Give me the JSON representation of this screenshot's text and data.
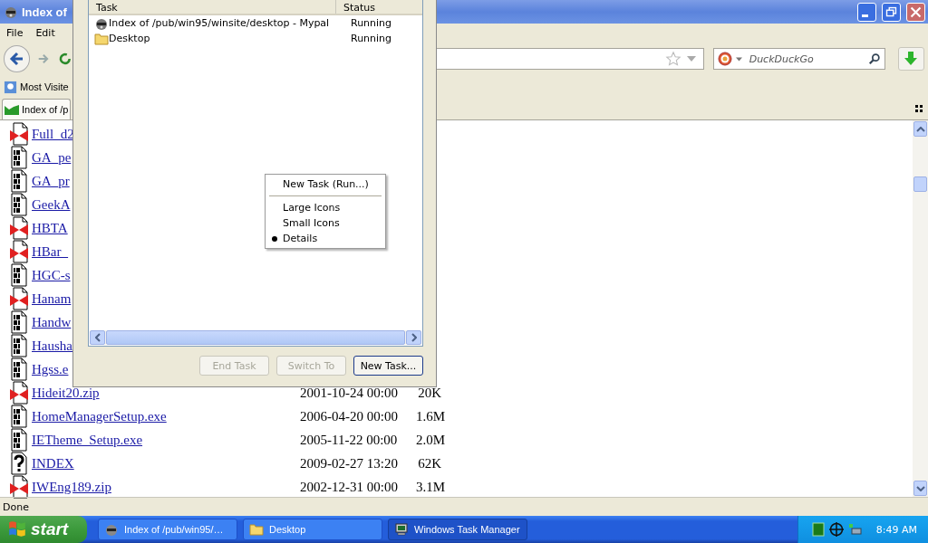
{
  "browser": {
    "title": "Index of",
    "menu": [
      "File",
      "Edit"
    ],
    "bookmarks": [
      "Most Visite"
    ],
    "tabs": [
      {
        "label": "Index of /p",
        "selected": true
      }
    ],
    "search": {
      "placeholder": "DuckDuckGo"
    },
    "files": [
      {
        "name": "Full_d2",
        "kind": "archive"
      },
      {
        "name": "GA_pe",
        "kind": "binary"
      },
      {
        "name": "GA_pr",
        "kind": "binary"
      },
      {
        "name": "GeekA",
        "kind": "binary"
      },
      {
        "name": "HBTA",
        "kind": "archive"
      },
      {
        "name": "HBar_",
        "kind": "archive"
      },
      {
        "name": "HGC-s",
        "kind": "binary"
      },
      {
        "name": "Hanam",
        "kind": "archive"
      },
      {
        "name": "Handw",
        "kind": "binary"
      },
      {
        "name": "Hausha",
        "kind": "binary"
      },
      {
        "name": "Hgss.e",
        "kind": "binary"
      },
      {
        "name": "Hideit20.zip",
        "kind": "archive",
        "date": "2001-10-24 00:00",
        "size": "20K"
      },
      {
        "name": "HomeManagerSetup.exe",
        "kind": "binary",
        "date": "2006-04-20 00:00",
        "size": "1.6M"
      },
      {
        "name": "IETheme_Setup.exe",
        "kind": "binary",
        "date": "2005-11-22 00:00",
        "size": "2.0M"
      },
      {
        "name": "INDEX",
        "kind": "unknown",
        "date": "2009-02-27 13:20",
        "size": "62K"
      },
      {
        "name": "IWEng189.zip",
        "kind": "archive",
        "date": "2002-12-31 00:00",
        "size": "3.1M"
      }
    ],
    "status": "Done"
  },
  "task_manager": {
    "columns": [
      "Task",
      "Status"
    ],
    "tasks": [
      {
        "name": "Index of /pub/win95/winsite/desktop - Mypal",
        "status": "Running",
        "kind": "browser"
      },
      {
        "name": "Desktop",
        "status": "Running",
        "kind": "folder"
      }
    ],
    "buttons": [
      {
        "label": "End Task",
        "disabled": true
      },
      {
        "label": "Switch To",
        "disabled": true
      },
      {
        "label": "New Task...",
        "disabled": false
      }
    ],
    "context_menu": [
      [
        {
          "label": "New Task (Run...)",
          "selected": false
        }
      ],
      [
        {
          "label": "Large Icons",
          "selected": false
        },
        {
          "label": "Small Icons",
          "selected": false
        },
        {
          "label": "Details",
          "selected": true
        }
      ]
    ]
  },
  "taskbar": {
    "start": "start",
    "items": [
      {
        "label": "Index of /pub/win95/…",
        "kind": "browser",
        "selected": false
      },
      {
        "label": "Desktop",
        "kind": "folder",
        "selected": false
      },
      {
        "label": "Windows Task Manager",
        "kind": "taskmgr",
        "selected": true
      }
    ],
    "clock": "8:49 AM"
  }
}
